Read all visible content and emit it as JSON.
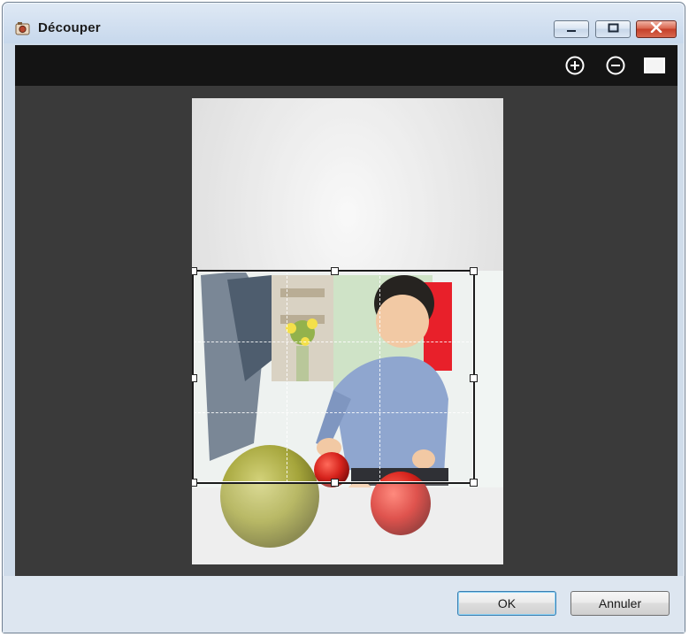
{
  "window": {
    "title": "Découper",
    "controls": {
      "minimize": "minimize-icon",
      "maximize": "maximize-icon",
      "close": "close-icon"
    }
  },
  "toolbar": {
    "zoom_in_icon": "zoom-in-icon",
    "zoom_out_icon": "zoom-out-icon",
    "fit_icon": "fit-to-window-icon"
  },
  "buttons": {
    "ok": "OK",
    "cancel": "Annuler"
  },
  "colors": {
    "toolbar_bg": "#141414",
    "canvas_bg": "#3a3a3a",
    "close_button": "#c5402a"
  }
}
